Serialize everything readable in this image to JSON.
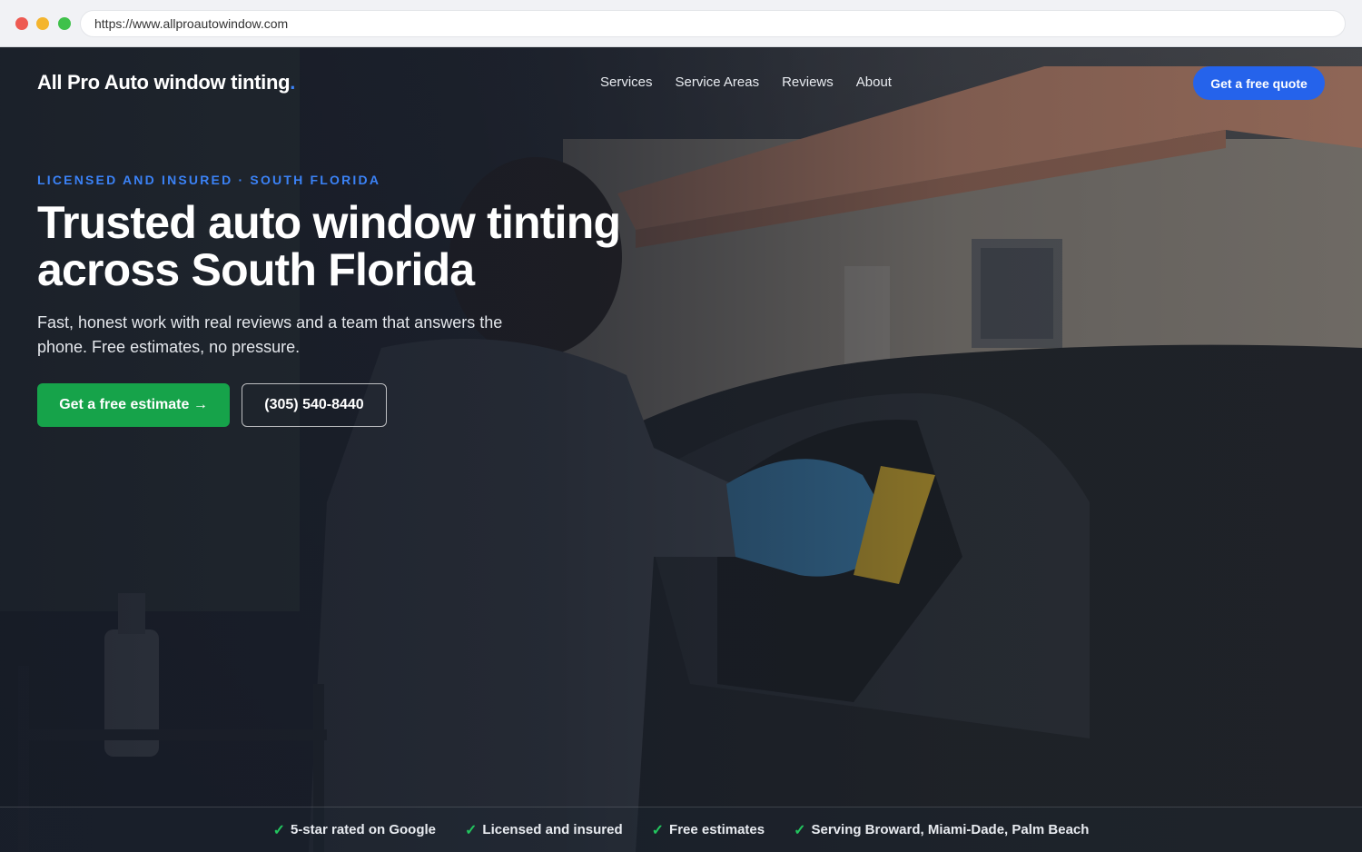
{
  "browser": {
    "url": "https://www.allproautowindow.com"
  },
  "nav": {
    "logo_text": "All Pro Auto window tinting",
    "logo_dot": ".",
    "links": [
      "Services",
      "Service Areas",
      "Reviews",
      "About"
    ],
    "cta": "Get a free quote"
  },
  "hero": {
    "eyebrow": "LICENSED AND INSURED · SOUTH FLORIDA",
    "headline_line1": "Trusted auto window tinting",
    "headline_line2": "across South Florida",
    "subtext": "Fast, honest work with real reviews and a team that answers the phone. Free estimates, no pressure.",
    "primary_cta": "Get a free estimate →",
    "secondary_cta": "(305) 540-8440"
  },
  "trust": {
    "check_icon": "✓",
    "items": [
      "5-star rated on Google",
      "Licensed and insured",
      "Free estimates",
      "Serving Broward, Miami-Dade, Palm Beach"
    ]
  },
  "colors": {
    "accent_blue": "#2563eb",
    "cta_green": "#16a34a",
    "check_green": "#22c55e"
  }
}
